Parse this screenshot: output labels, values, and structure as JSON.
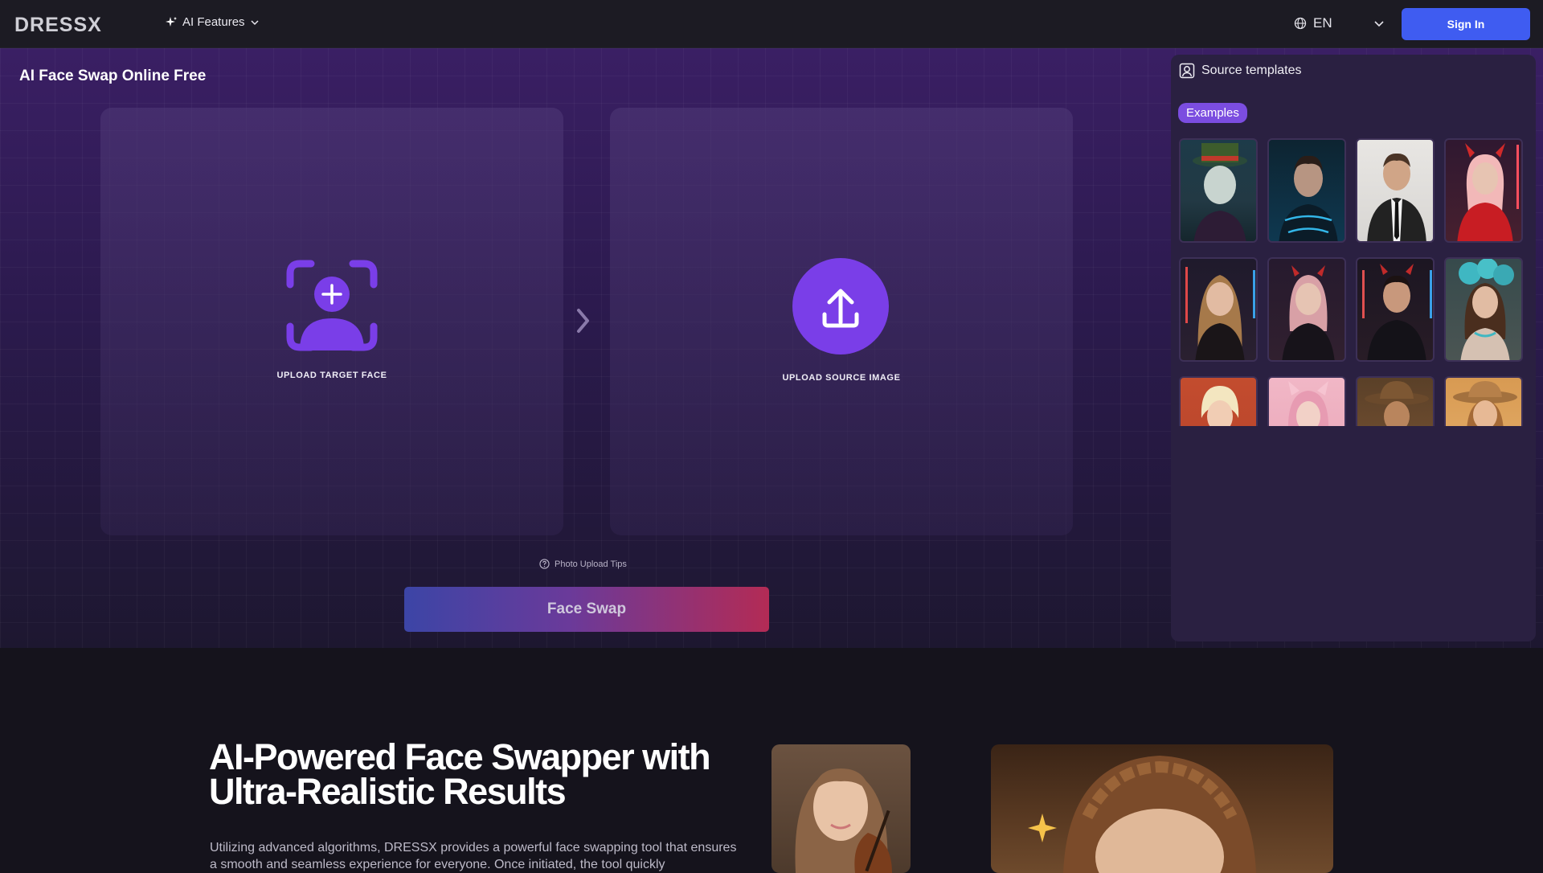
{
  "nav": {
    "logo": "DRESSX",
    "ai_features": "AI Features",
    "language": "EN",
    "sign_in": "Sign In"
  },
  "tool": {
    "title": "AI Face Swap Online Free",
    "upload_target": "UPLOAD TARGET FACE",
    "upload_source": "UPLOAD SOURCE IMAGE",
    "tips": "Photo Upload Tips",
    "swap_button": "Face Swap"
  },
  "side": {
    "heading": "Source templates",
    "chip": "Examples"
  },
  "lower": {
    "title": "AI-Powered Face Swapper with Ultra-Realistic Results",
    "text": "Utilizing advanced algorithms, DRESSX provides a powerful face swapping tool that ensures a smooth and seamless experience for everyone. Once initiated, the tool quickly"
  },
  "colors": {
    "accent": "#7b4de0",
    "sign_in": "#3f5cf1",
    "upload_purple": "#7a3ee8"
  }
}
